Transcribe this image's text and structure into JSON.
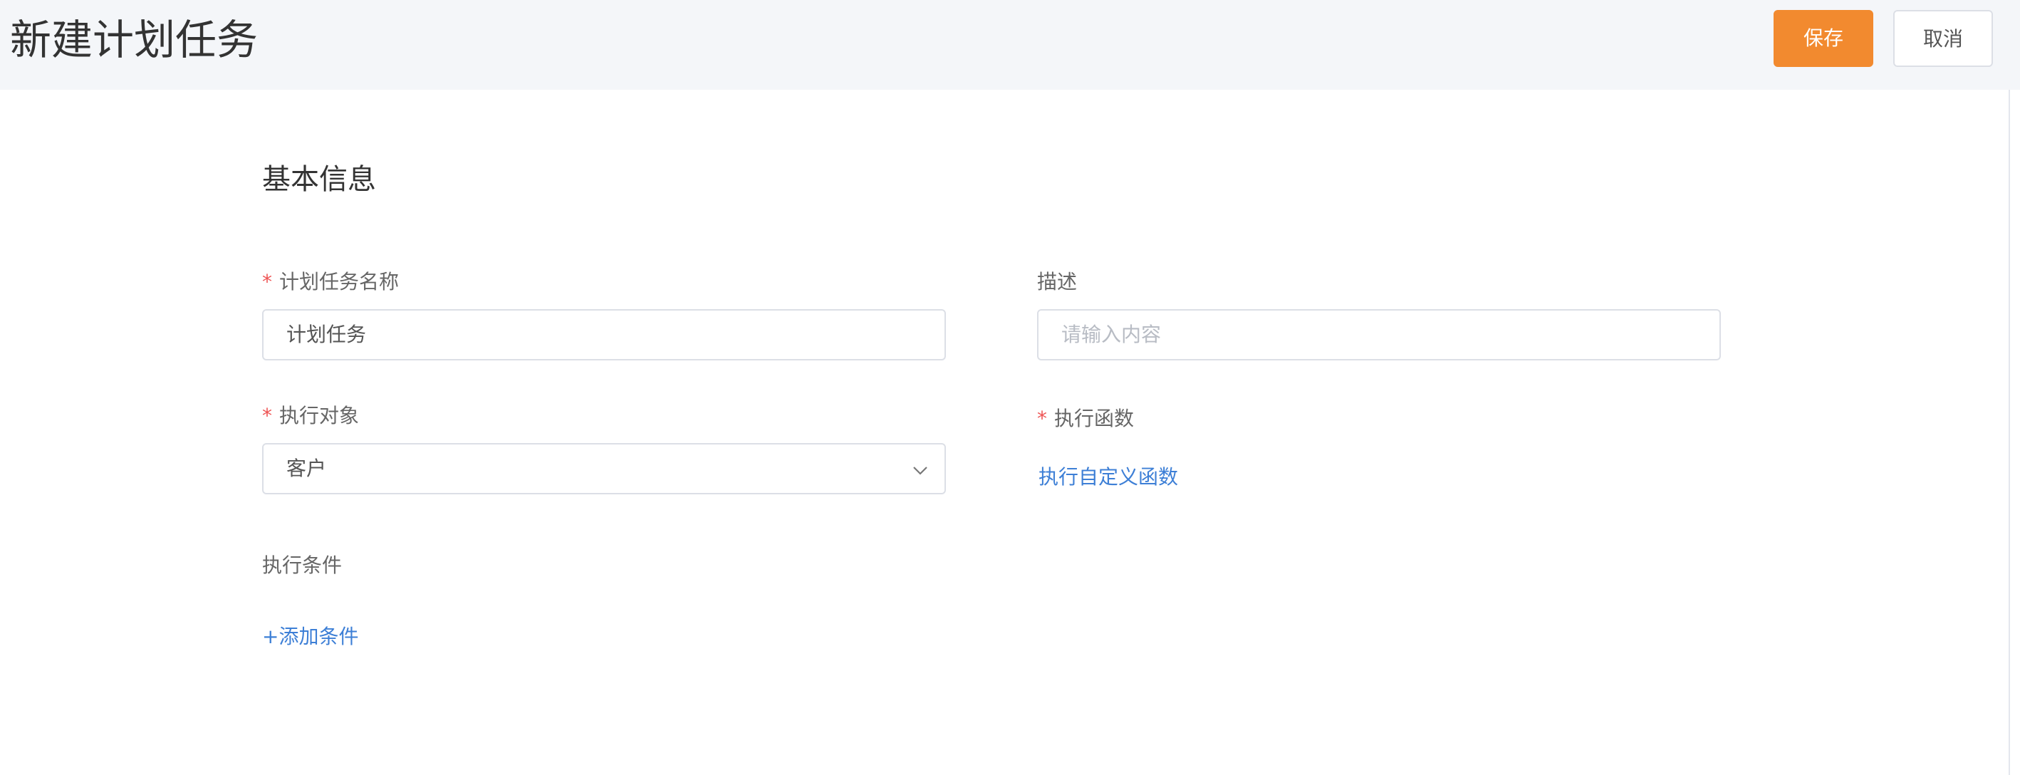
{
  "header": {
    "title": "新建计划任务",
    "save_label": "保存",
    "cancel_label": "取消"
  },
  "form": {
    "section_title": "基本信息",
    "task_name": {
      "label": "计划任务名称",
      "required": "*",
      "value": "计划任务"
    },
    "description": {
      "label": "描述",
      "placeholder": "请输入内容"
    },
    "target": {
      "label": "执行对象",
      "required": "*",
      "value": "客户"
    },
    "function": {
      "label": "执行函数",
      "required": "*",
      "link": "执行自定义函数"
    },
    "condition": {
      "label": "执行条件",
      "add_link": "+添加条件"
    }
  },
  "colors": {
    "accent": "#f28a2f",
    "link": "#3d7fd6",
    "required": "#ee5555",
    "header_bg": "#f4f6f9"
  }
}
